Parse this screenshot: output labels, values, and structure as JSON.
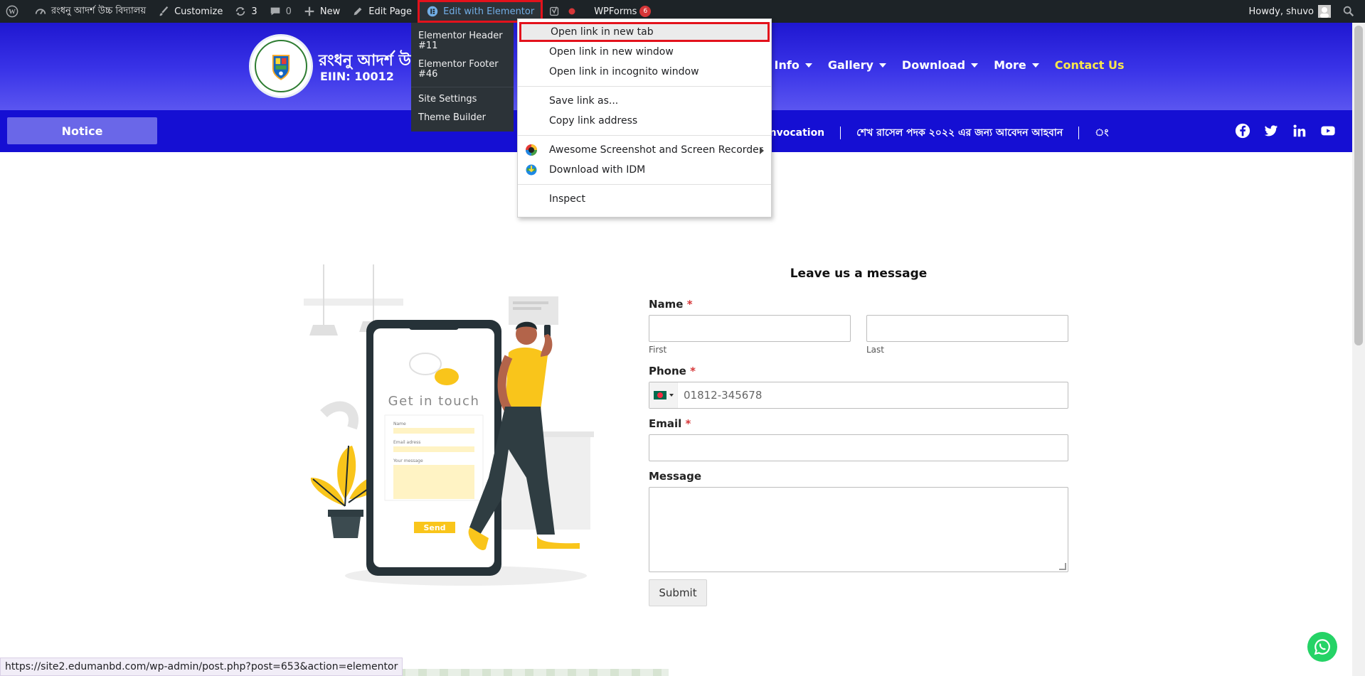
{
  "adminbar": {
    "site_name": "রংধনু আদর্শ উচ্চ বিদ্যালয়",
    "customize": "Customize",
    "updates_count": "3",
    "comments_count": "0",
    "new": "New",
    "edit_page": "Edit Page",
    "edit_elementor": "Edit with Elementor",
    "wpforms": "WPForms",
    "wpforms_count": "6",
    "howdy": "Howdy, shuvo"
  },
  "elementor_menu": {
    "items": [
      "Elementor Header #11",
      "Elementor Footer #46",
      "Site Settings",
      "Theme Builder"
    ]
  },
  "context_menu": {
    "items": [
      "Open link in new tab",
      "Open link in new window",
      "Open link in incognito window",
      "Save link as...",
      "Copy link address",
      "Awesome Screenshot and Screen Recorder",
      "Download with IDM",
      "Inspect"
    ]
  },
  "header": {
    "title": "রংধনু আদর্শ উ",
    "eiin": "EIIN: 10012",
    "nav": [
      "ic Info",
      "Gallery",
      "Download",
      "More",
      "Contact Us"
    ]
  },
  "notice_bar": {
    "notice_label": "Notice",
    "ticker": [
      "onvocation",
      "শেখ রাসেল পদক ২০২২ এর জন্য আবেদন আহবান",
      "ং"
    ]
  },
  "illustration": {
    "heading": "Get in touch",
    "fields": [
      "Name",
      "Email adress",
      "Your message"
    ],
    "send": "Send"
  },
  "form": {
    "title": "Leave us a message",
    "name_label": "Name",
    "first": "First",
    "last": "Last",
    "phone_label": "Phone",
    "phone_placeholder": "01812-345678",
    "email_label": "Email",
    "message_label": "Message",
    "required_mark": "*",
    "submit": "Submit"
  },
  "statusbar": {
    "url": "https://site2.edumanbd.com/wp-admin/post.php?post=653&action=elementor"
  }
}
